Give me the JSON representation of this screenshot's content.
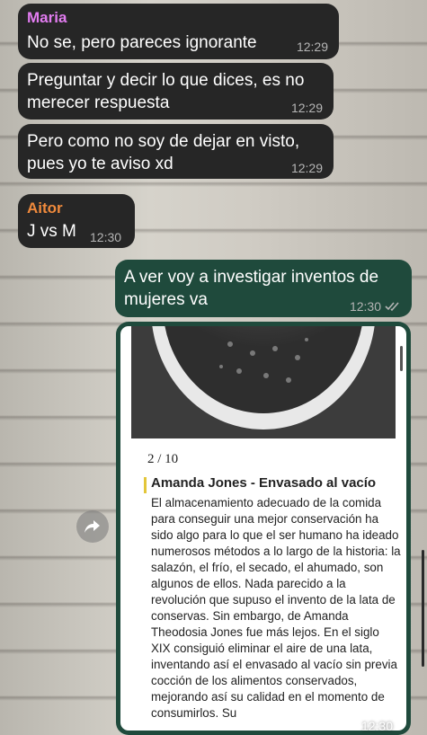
{
  "messages": [
    {
      "sender": "Maria",
      "text": "No se, pero pareces ignorante",
      "time": "12:29"
    },
    {
      "text": "Preguntar y decir lo que dices, es no merecer respuesta",
      "time": "12:29"
    },
    {
      "text": "Pero como no soy de dejar en visto, pues yo te aviso xd",
      "time": "12:29"
    },
    {
      "sender": "Aitor",
      "text": "J vs M",
      "time": "12:30"
    },
    {
      "text": "A ver voy a investigar inventos de mujeres va",
      "time": "12:30"
    }
  ],
  "colors": {
    "maria": "#e27cf0",
    "aitor": "#f08a3c",
    "incoming_bubble": "#262626",
    "outgoing_bubble": "#1f4a3c",
    "highlight_bar": "#e3c63a"
  },
  "card": {
    "counter": "2 / 10",
    "headline": "Amanda Jones - Envasado al vacío",
    "body": "El almacenamiento adecuado de la comida para conseguir una mejor conservación ha sido algo para lo que el ser humano ha ideado numerosos métodos a lo largo de la historia: la salazón, el frío, el secado, el ahumado, son algunos de ellos. Nada parecido a la revolución que supuso el invento de la lata de conservas. Sin embargo, de Amanda Theodosia Jones fue más lejos. En el siglo XIX consiguió eliminar el aire de una lata, inventando así el envasado al vacío sin previa cocción de los alimentos conservados, mejorando así su calidad en el momento de consumirlos. Su",
    "time": "12:30"
  },
  "icons": {
    "forward": "forward-arrow-icon",
    "read": "double-check-icon"
  }
}
